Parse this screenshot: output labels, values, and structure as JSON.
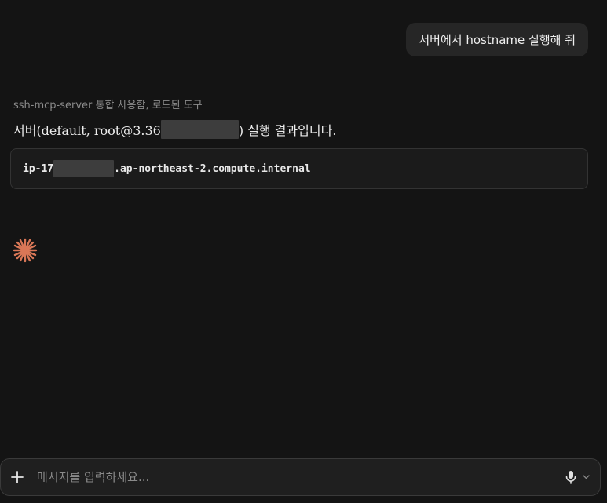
{
  "user_message": "서버에서 hostname 실행해 줘",
  "assistant": {
    "tool_status": "ssh-mcp-server 통합 사용함, 로드된 도구",
    "reply_prefix": "서버(default, root@3.36",
    "reply_suffix": ") 실행 결과입니다.",
    "code_prefix": "ip-17",
    "code_suffix": ".ap-northeast-2.compute.internal"
  },
  "composer": {
    "placeholder": "메시지를 입력하세요..."
  },
  "icons": {
    "spark": "asterisk-spark-icon",
    "plus": "plus-icon",
    "mic": "microphone-icon",
    "chevron": "chevron-down-icon"
  },
  "colors": {
    "background": "#141414",
    "spark": "#d97757",
    "bubble": "#262626"
  }
}
